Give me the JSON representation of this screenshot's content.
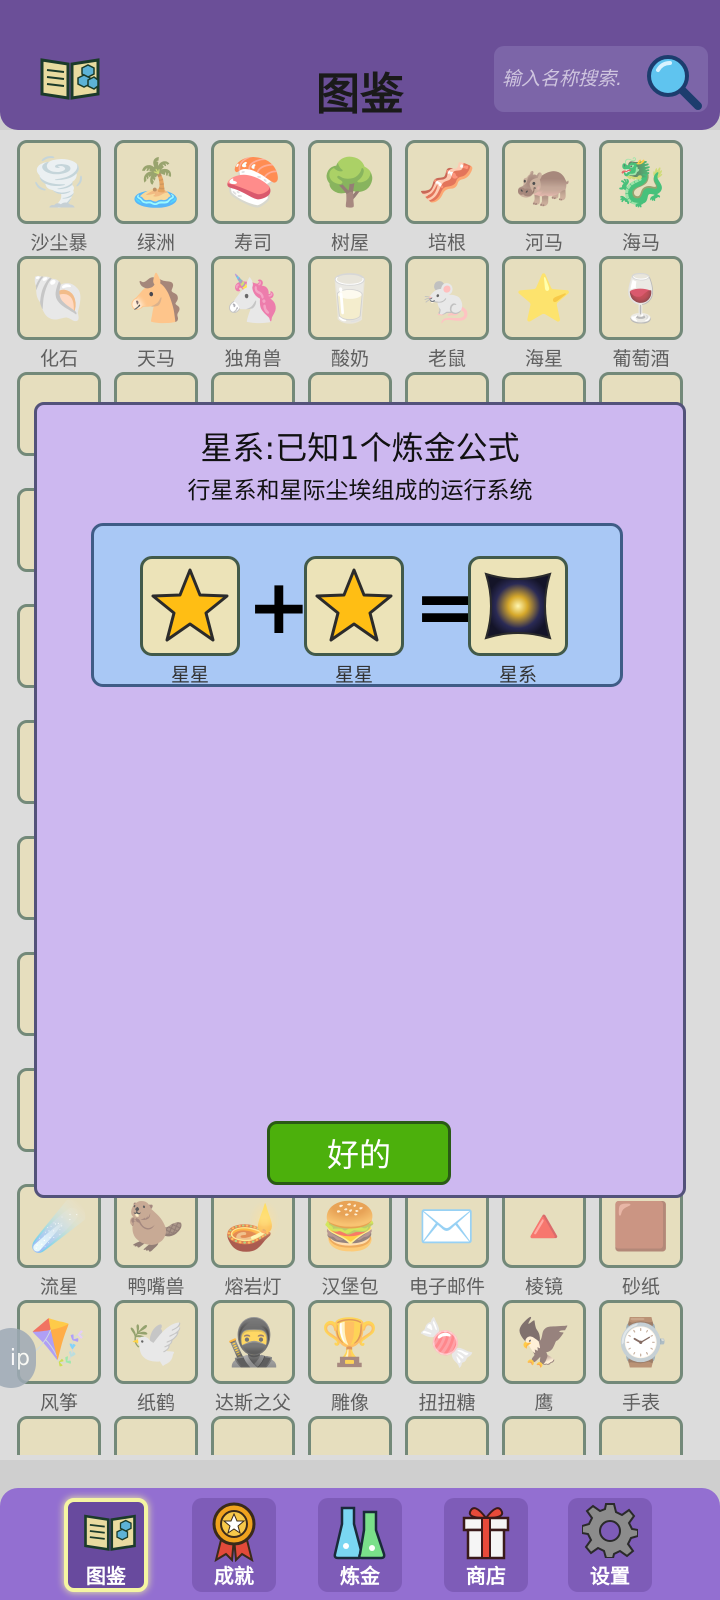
{
  "header": {
    "title": "图鉴",
    "search_placeholder": "输入名称搜索."
  },
  "grid": {
    "items": [
      {
        "label": "沙尘暴",
        "icon": "tornado-icon"
      },
      {
        "label": "绿洲",
        "icon": "palm-tree-icon"
      },
      {
        "label": "寿司",
        "icon": "sushi-icon"
      },
      {
        "label": "树屋",
        "icon": "treehouse-icon"
      },
      {
        "label": "培根",
        "icon": "bacon-icon"
      },
      {
        "label": "河马",
        "icon": "hippo-icon"
      },
      {
        "label": "海马",
        "icon": "seahorse-icon"
      },
      {
        "label": "化石",
        "icon": "fossil-icon"
      },
      {
        "label": "天马",
        "icon": "pegasus-icon"
      },
      {
        "label": "独角兽",
        "icon": "unicorn-icon"
      },
      {
        "label": "酸奶",
        "icon": "yogurt-icon"
      },
      {
        "label": "老鼠",
        "icon": "mouse-icon"
      },
      {
        "label": "海星",
        "icon": "starfish-icon"
      },
      {
        "label": "葡萄酒",
        "icon": "wine-icon"
      },
      {
        "label": "流星",
        "icon": "meteor-icon"
      },
      {
        "label": "鸭嘴兽",
        "icon": "platypus-icon"
      },
      {
        "label": "熔岩灯",
        "icon": "lava-lamp-icon"
      },
      {
        "label": "汉堡包",
        "icon": "burger-icon"
      },
      {
        "label": "电子邮件",
        "icon": "email-icon"
      },
      {
        "label": "棱镜",
        "icon": "prism-icon"
      },
      {
        "label": "砂纸",
        "icon": "sandpaper-icon"
      },
      {
        "label": "风筝",
        "icon": "kite-icon"
      },
      {
        "label": "纸鹤",
        "icon": "paper-crane-icon"
      },
      {
        "label": "达斯之父",
        "icon": "darth-vader-icon"
      },
      {
        "label": "雕像",
        "icon": "statue-icon"
      },
      {
        "label": "扭扭糖",
        "icon": "twist-candy-icon"
      },
      {
        "label": "鹰",
        "icon": "eagle-icon"
      },
      {
        "label": "手表",
        "icon": "watch-icon"
      }
    ]
  },
  "modal": {
    "title": "星系:已知1个炼金公式",
    "subtitle": "行星系和星际尘埃组成的运行系统",
    "formula": {
      "input1": "星星",
      "operator1": "+",
      "input2": "星星",
      "operator2": "=",
      "output": "星系"
    },
    "ok_label": "好的"
  },
  "side_pill": {
    "text": "ip"
  },
  "nav": {
    "items": [
      {
        "label": "图鉴",
        "icon": "book-icon",
        "active": true
      },
      {
        "label": "成就",
        "icon": "medal-icon",
        "active": false
      },
      {
        "label": "炼金",
        "icon": "flask-icon",
        "active": false
      },
      {
        "label": "商店",
        "icon": "gift-icon",
        "active": false
      },
      {
        "label": "设置",
        "icon": "gear-icon",
        "active": false
      }
    ]
  },
  "colors": {
    "header_bg": "#6b4f98",
    "modal_bg": "#cdb8f0",
    "formula_bg": "#a9c8f5",
    "ok_button": "#4cb00c",
    "nav_bg": "#936fd1",
    "tile_bg": "#ddd1a6",
    "tile_border": "#3d5c46"
  }
}
